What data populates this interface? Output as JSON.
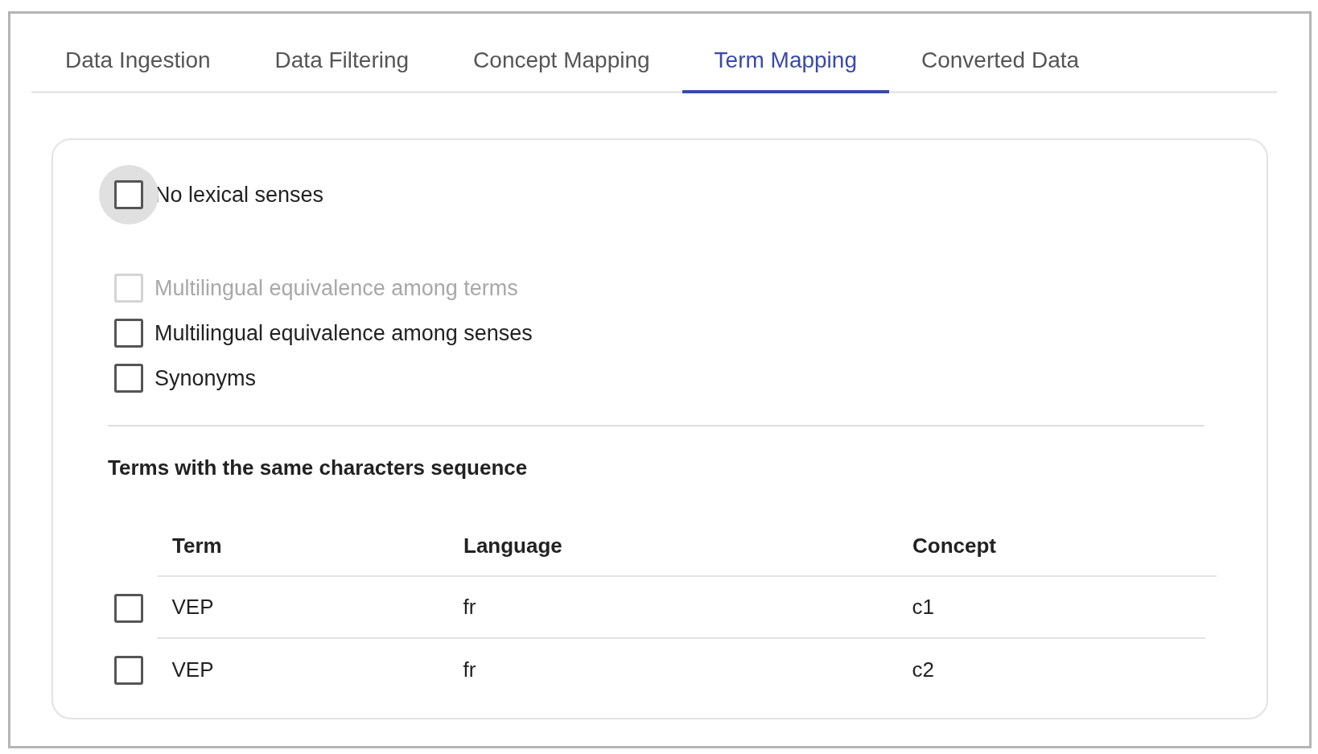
{
  "tabs": [
    {
      "label": "Data Ingestion",
      "selected": false
    },
    {
      "label": "Data Filtering",
      "selected": false
    },
    {
      "label": "Concept Mapping",
      "selected": false
    },
    {
      "label": "Term Mapping",
      "selected": true
    },
    {
      "label": "Converted Data",
      "selected": false
    }
  ],
  "options": [
    {
      "label": "No lexical senses",
      "checked": false,
      "disabled": false,
      "focused": true
    },
    {
      "label": "Multilingual equivalence among terms",
      "checked": false,
      "disabled": true,
      "focused": false
    },
    {
      "label": "Multilingual equivalence among senses",
      "checked": false,
      "disabled": false,
      "focused": false
    },
    {
      "label": "Synonyms",
      "checked": false,
      "disabled": false,
      "focused": false
    }
  ],
  "section_title": "Terms with the same characters sequence",
  "table": {
    "columns": [
      "Term",
      "Language",
      "Concept"
    ],
    "rows": [
      {
        "checked": false,
        "cells": [
          "VEP",
          "fr",
          "c1"
        ]
      },
      {
        "checked": false,
        "cells": [
          "VEP",
          "fr",
          "c2"
        ]
      }
    ]
  }
}
